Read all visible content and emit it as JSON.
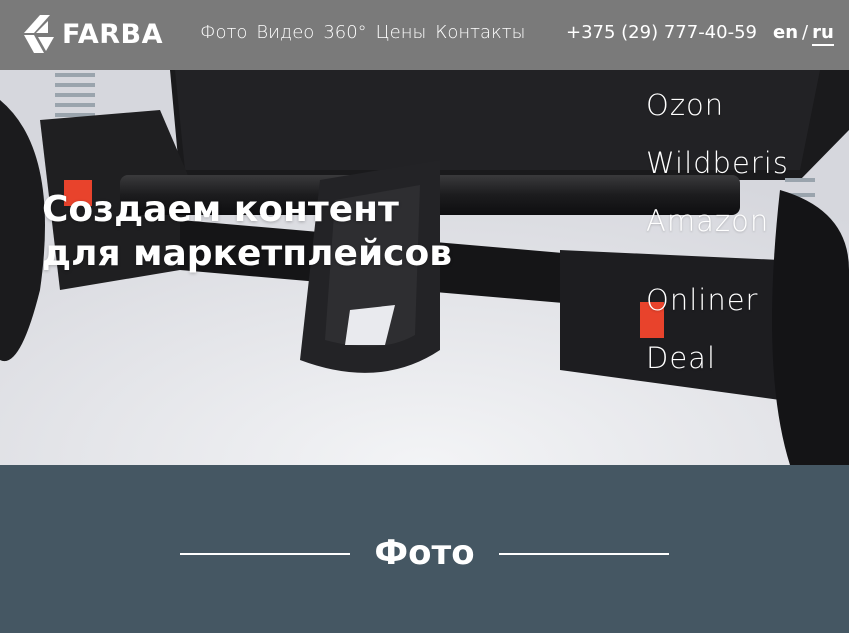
{
  "header": {
    "logo_text": "FARBA",
    "nav": [
      "Фото",
      "Видео",
      "360°",
      "Цены",
      "Контакты"
    ],
    "phone": "+375 (29) 777-40-59",
    "lang_en": "en",
    "lang_sep": "/",
    "lang_ru": "ru"
  },
  "hero": {
    "title_line1": "Создаем контент",
    "title_line2": "для маркетплейсов",
    "marketplaces": [
      "Ozon",
      "Wildberis",
      "Amazon",
      "Onliner",
      "Deal"
    ]
  },
  "section": {
    "title": "Фото"
  },
  "colors": {
    "header_bg": "#7a7a7a",
    "section_bg": "#455763",
    "accent_red": "#e8432c"
  }
}
